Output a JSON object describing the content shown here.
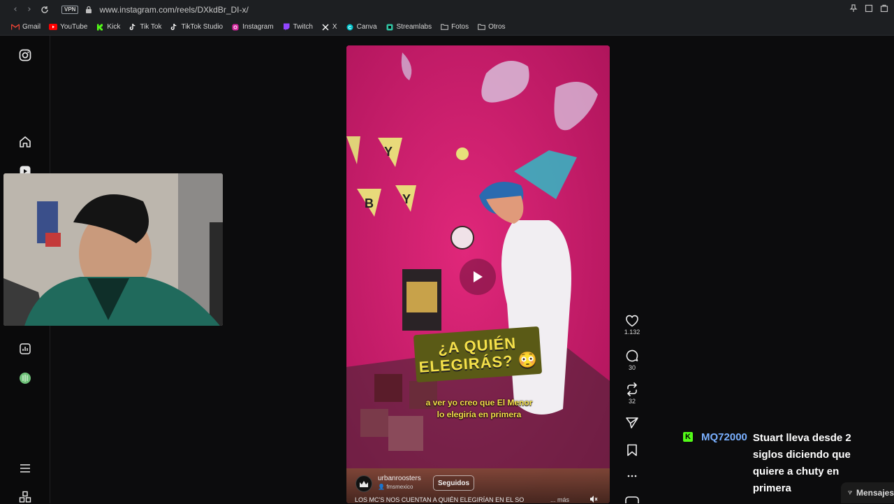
{
  "browser": {
    "url": "www.instagram.com/reels/DXkdBr_DI-x/",
    "vpn_label": "VPN",
    "bookmarks": [
      {
        "label": "Gmail",
        "icon": "gmail-icon",
        "color": "#ea4335"
      },
      {
        "label": "YouTube",
        "icon": "youtube-icon",
        "color": "#ff0000"
      },
      {
        "label": "Kick",
        "icon": "kick-icon",
        "color": "#53fc18"
      },
      {
        "label": "Tik Tok",
        "icon": "tiktok-icon",
        "color": "#ffffff"
      },
      {
        "label": "TikTok Studio",
        "icon": "tiktok-icon",
        "color": "#ffffff"
      },
      {
        "label": "Instagram",
        "icon": "instagram-icon",
        "color": "#d6249f"
      },
      {
        "label": "Twitch",
        "icon": "twitch-icon",
        "color": "#9146ff"
      },
      {
        "label": "X",
        "icon": "x-icon",
        "color": "#ffffff"
      },
      {
        "label": "Canva",
        "icon": "canva-icon",
        "color": "#00c4cc"
      },
      {
        "label": "Streamlabs",
        "icon": "streamlabs-icon",
        "color": "#31c3a2"
      },
      {
        "label": "Fotos",
        "icon": "folder-icon",
        "color": "#cfcfcf"
      },
      {
        "label": "Otros",
        "icon": "folder-icon",
        "color": "#cfcfcf"
      }
    ]
  },
  "reel": {
    "overlay_title_line1": "¿A QUIÉN",
    "overlay_title_line2": "ELEGIRÁS? 😳",
    "subtitle_line1": "a ver yo creo que El Menor",
    "subtitle_line2": "lo elegiría en primera",
    "account_name": "urbanroosters",
    "account_sub": "fmsmexico",
    "follow_label": "Seguidos",
    "caption": "LOS MC'S NOS CUENTAN A QUIÉN ELEGIRÍAN EN EL SO",
    "more_label": "... más",
    "likes": "1.132",
    "comments": "30",
    "reposts": "32"
  },
  "chat": {
    "username": "MQ72000",
    "message": "Stuart lleva desde 2 siglos diciendo que quiere a chuty en primera",
    "badge": "K"
  },
  "messages_button": "Mensajes"
}
